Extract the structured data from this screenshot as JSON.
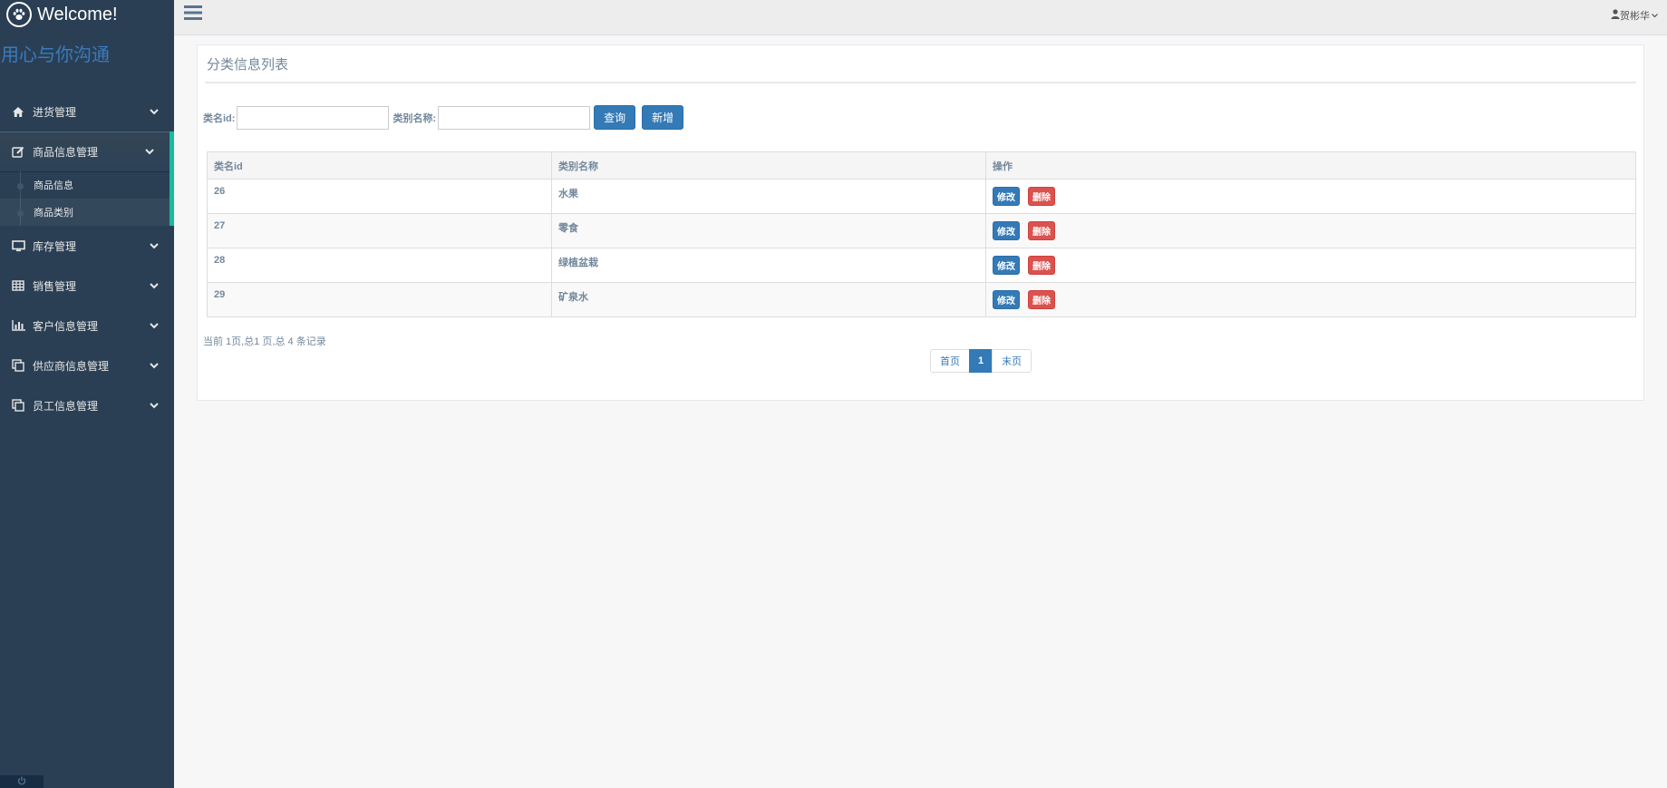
{
  "sidebar": {
    "brand_title": "Welcome!",
    "slogan": "用心与你沟通",
    "menu": [
      {
        "label": "进货管理",
        "icon": "home-icon"
      },
      {
        "label": "商品信息管理",
        "icon": "edit-icon",
        "active": true,
        "children": [
          {
            "label": "商品信息"
          },
          {
            "label": "商品类别",
            "current": true
          }
        ]
      },
      {
        "label": "库存管理",
        "icon": "desktop-icon"
      },
      {
        "label": "销售管理",
        "icon": "table-icon"
      },
      {
        "label": "客户信息管理",
        "icon": "bar-chart-icon"
      },
      {
        "label": "供应商信息管理",
        "icon": "clone-icon"
      },
      {
        "label": "员工信息管理",
        "icon": "clone-icon"
      }
    ]
  },
  "topbar": {
    "user_name": "贺彬华"
  },
  "panel": {
    "title": "分类信息列表",
    "search": {
      "id_label": "类名id:",
      "id_value": "",
      "name_label": "类别名称:",
      "name_value": "",
      "query_button": "查询",
      "add_button": "新增"
    },
    "table": {
      "headers": [
        "类名id",
        "类别名称",
        "操作"
      ],
      "rows": [
        {
          "id": "26",
          "name": "水果"
        },
        {
          "id": "27",
          "name": "零食"
        },
        {
          "id": "28",
          "name": "绿植盆栽"
        },
        {
          "id": "29",
          "name": "矿泉水"
        }
      ],
      "edit_label": "修改",
      "delete_label": "删除"
    },
    "summary": "当前 1页,总1 页,总 4 条记录",
    "pagination": {
      "first": "首页",
      "current": "1",
      "last": "末页"
    }
  },
  "colors": {
    "sidebar_bg": "#2a3f54",
    "accent_green": "#1abb9c",
    "primary": "#337ab7",
    "danger": "#d9534f"
  }
}
